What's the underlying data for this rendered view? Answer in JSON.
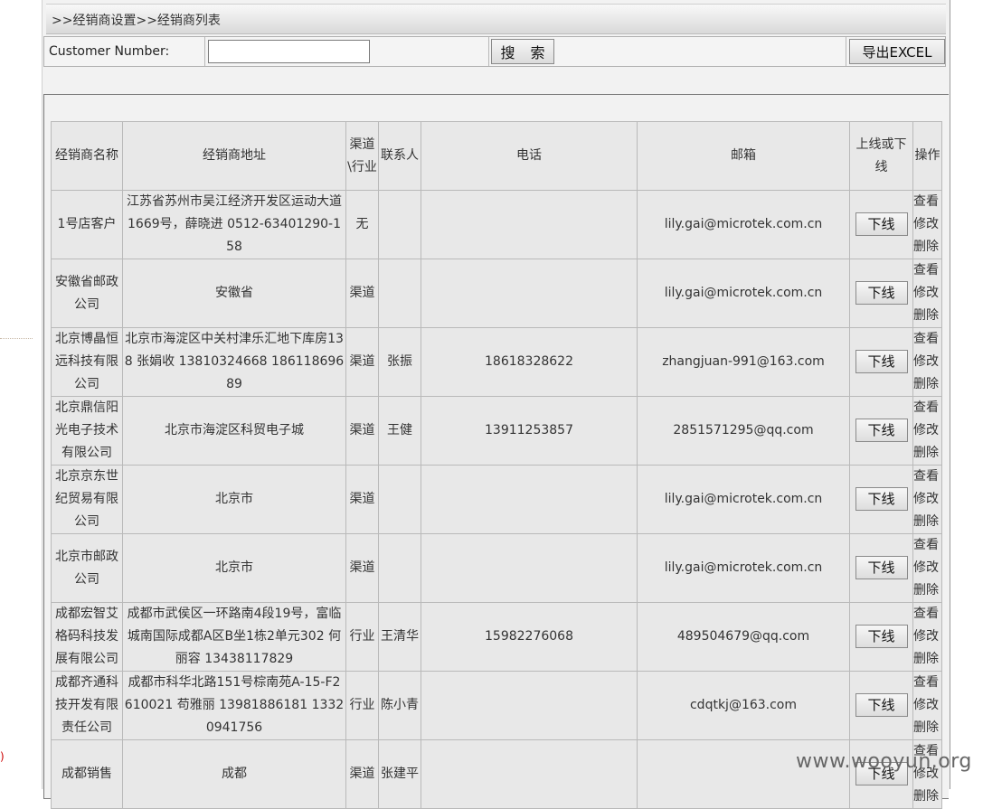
{
  "breadcrumb": ">>经销商设置>>经销商列表",
  "search": {
    "label": "Customer Number:",
    "value": "",
    "button_label": "搜 索",
    "export_label": "导出EXCEL"
  },
  "table": {
    "headers": [
      "经销商名称",
      "经销商地址",
      "渠道\\行业",
      "联系人",
      "电话",
      "邮箱",
      "上线或下线",
      "操作"
    ],
    "rows": [
      {
        "name": "1号店客户",
        "address": "江苏省苏州市吴江经济开发区运动大道1669号，薛晓进 0512-63401290-158",
        "channel": "无",
        "contact": "",
        "phone": "",
        "email": "lily.gai@microtek.com.cn",
        "status_button": "下线",
        "ops": [
          "查看",
          "修改",
          "删除"
        ]
      },
      {
        "name": "安徽省邮政公司",
        "address": "安徽省",
        "channel": "渠道",
        "contact": "",
        "phone": "",
        "email": "lily.gai@microtek.com.cn",
        "status_button": "下线",
        "ops": [
          "查看",
          "修改",
          "删除"
        ]
      },
      {
        "name": "北京博晶恒远科技有限公司",
        "address": "北京市海淀区中关村津乐汇地下库房138 张娟收 13810324668 18611869689",
        "channel": "渠道",
        "contact": "张振",
        "phone": "18618328622",
        "email": "zhangjuan-991@163.com",
        "status_button": "下线",
        "ops": [
          "查看",
          "修改",
          "删除"
        ]
      },
      {
        "name": "北京鼎信阳光电子技术有限公司",
        "address": "北京市海淀区科贸电子城",
        "channel": "渠道",
        "contact": "王健",
        "phone": "13911253857",
        "email": "2851571295@qq.com",
        "status_button": "下线",
        "ops": [
          "查看",
          "修改",
          "删除"
        ]
      },
      {
        "name": "北京京东世纪贸易有限公司",
        "address": "北京市",
        "channel": "渠道",
        "contact": "",
        "phone": "",
        "email": "lily.gai@microtek.com.cn",
        "status_button": "下线",
        "ops": [
          "查看",
          "修改",
          "删除"
        ]
      },
      {
        "name": "北京市邮政公司",
        "address": "北京市",
        "channel": "渠道",
        "contact": "",
        "phone": "",
        "email": "lily.gai@microtek.com.cn",
        "status_button": "下线",
        "ops": [
          "查看",
          "修改",
          "删除"
        ]
      },
      {
        "name": "成都宏智艾格码科技发展有限公司",
        "address": "成都市武侯区一环路南4段19号，富临城南国际成都A区B坐1栋2单元302 何丽容 13438117829",
        "channel": "行业",
        "contact": "王清华",
        "phone": "15982276068",
        "email": "489504679@qq.com",
        "status_button": "下线",
        "ops": [
          "查看",
          "修改",
          "删除"
        ]
      },
      {
        "name": "成都齐通科技开发有限责任公司",
        "address": "成都市科华北路151号棕南苑A-15-F2 610021 苟雅丽 13981886181 13320941756",
        "channel": "行业",
        "contact": "陈小青",
        "phone": "",
        "email": "cdqtkj@163.com",
        "status_button": "下线",
        "ops": [
          "查看",
          "修改",
          "删除"
        ]
      },
      {
        "name": "成都销售",
        "address": "成都",
        "channel": "渠道",
        "contact": "张建平",
        "phone": "",
        "email": "",
        "status_button": "下线",
        "ops": [
          "查看",
          "修改",
          "删除"
        ]
      }
    ]
  },
  "watermark": "www.wooyun.org",
  "left_mark": ")"
}
